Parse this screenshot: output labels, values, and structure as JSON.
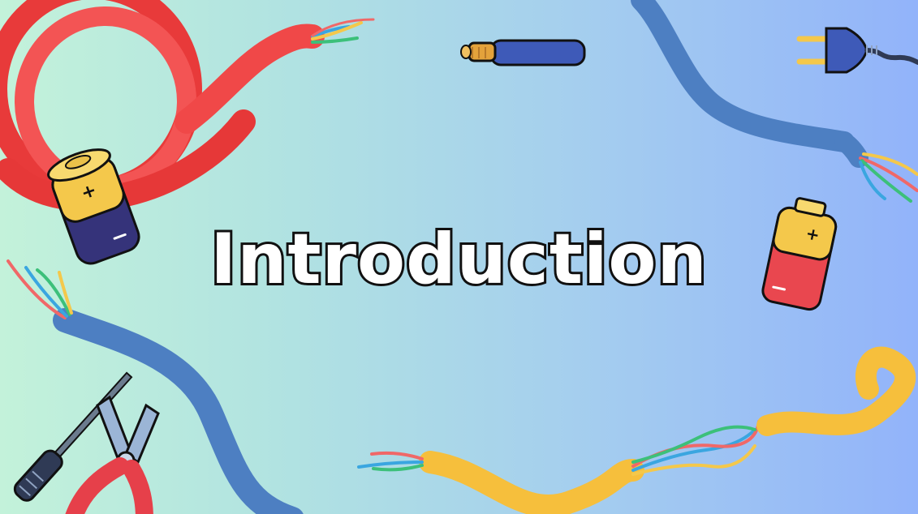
{
  "slide": {
    "title": "Introduction",
    "background_colors": [
      "#c3f2da",
      "#b1e3e1",
      "#a4cdef",
      "#92b3fa"
    ]
  },
  "illustrations": [
    "red-cable-coil-icon",
    "blue-cable-icon",
    "yellow-cable-icon",
    "battery-icon",
    "power-plug-icon",
    "screwdriver-icon",
    "pliers-icon",
    "audio-jack-icon"
  ],
  "colors": {
    "red_cable": "#f0413f",
    "blue_cable": "#4d7fc2",
    "yellow_cable": "#f6bf3c",
    "battery_yellow": "#f4c84b",
    "battery_navy": "#35337a",
    "outline": "#111111"
  }
}
